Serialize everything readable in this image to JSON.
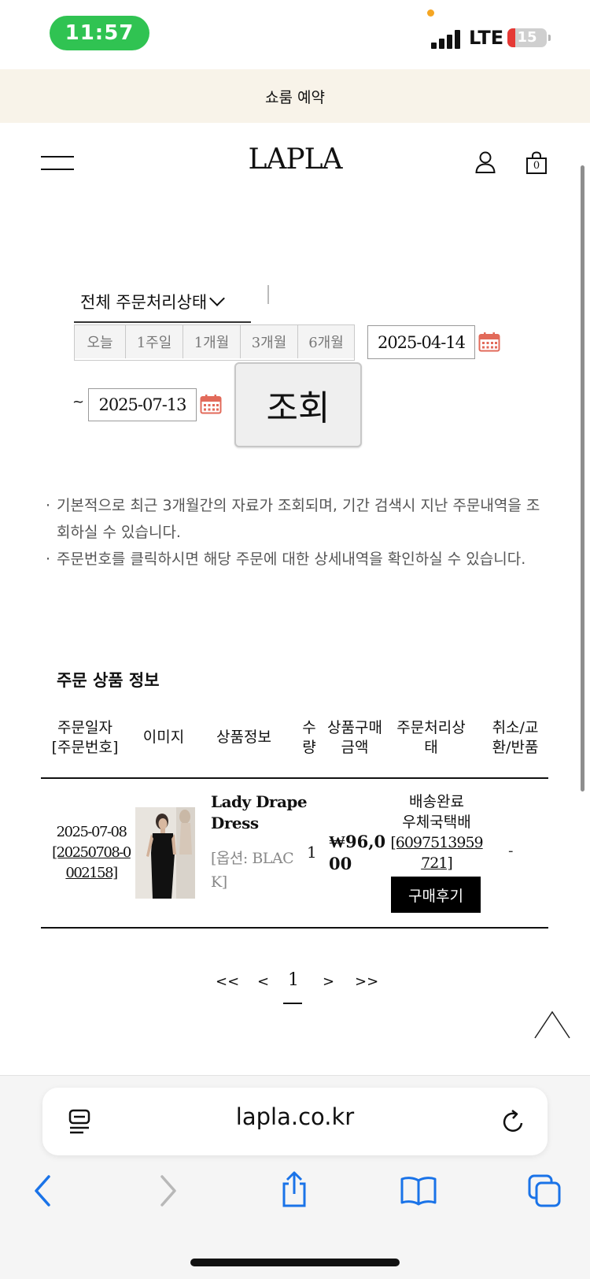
{
  "status_bar": {
    "time": "11:57",
    "network": "LTE",
    "battery": "15"
  },
  "banner": {
    "text": "쇼룸 예약"
  },
  "header": {
    "logo": "LAPLA",
    "cart_count": "0"
  },
  "filter": {
    "status_select": "전체 주문처리상태",
    "periods": [
      "오늘",
      "1주일",
      "1개월",
      "3개월",
      "6개월"
    ],
    "start_date": "2025-04-14",
    "separator": "~",
    "end_date": "2025-07-13",
    "search_label": "조회"
  },
  "notes": [
    "기본적으로 최근 3개월간의 자료가 조회되며, 기간 검색시 지난 주문내역을 조회하실 수 있습니다.",
    "주문번호를 클릭하시면 해당 주문에 대한 상세내역을 확인하실 수 있습니다."
  ],
  "orders": {
    "section_title": "주문 상품 정보",
    "columns": {
      "date": [
        "주문일자",
        "[주문번호]"
      ],
      "image": "이미지",
      "info": "상품정보",
      "qty": [
        "수",
        "량"
      ],
      "amount": [
        "상품구매",
        "금액"
      ],
      "status": [
        "주문처리상",
        "태"
      ],
      "cancel": [
        "취소/교",
        "환/반품"
      ]
    },
    "rows": [
      {
        "date": "2025-07-08",
        "order_no": "[20250708-0002158]",
        "product_name": "Lady Drape Dress",
        "option": "[옵션: BLACK]",
        "qty": "1",
        "price": "₩96,000",
        "status": "배송완료",
        "carrier": "우체국택배",
        "tracking": "[6097513959721]",
        "review_label": "구매후기",
        "cancel": "-"
      }
    ]
  },
  "pagination": {
    "first": "<<",
    "prev": "<",
    "current": "1",
    "next": ">",
    "last": ">>"
  },
  "browser": {
    "url": "lapla.co.kr"
  }
}
